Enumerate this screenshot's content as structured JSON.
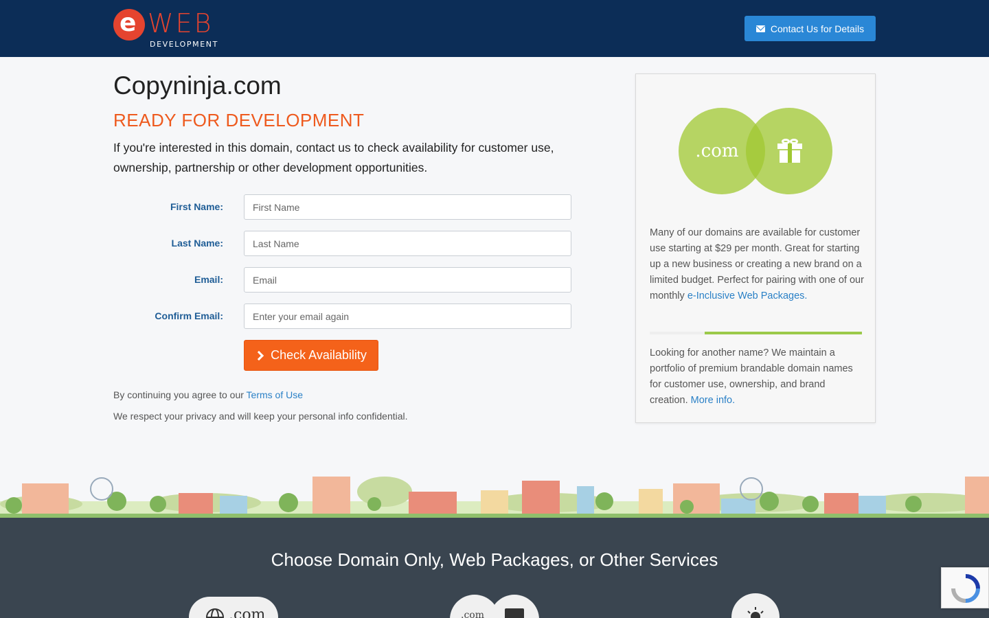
{
  "header": {
    "logo_letter": "e",
    "logo_word": "WEB",
    "logo_sub": "DEVELOPMENT",
    "contact_button": "Contact Us for Details"
  },
  "main": {
    "domain": "Copyninja.com",
    "status": "READY FOR DEVELOPMENT",
    "intro": "If you're interested in this domain, contact us to check availability for customer use, ownership, partnership or other development opportunities."
  },
  "form": {
    "first_name": {
      "label": "First Name:",
      "placeholder": "First Name"
    },
    "last_name": {
      "label": "Last Name:",
      "placeholder": "Last Name"
    },
    "email": {
      "label": "Email:",
      "placeholder": "Email"
    },
    "confirm_email": {
      "label": "Confirm Email:",
      "placeholder": "Enter your email again"
    },
    "submit": "Check Availability",
    "terms_prefix": "By continuing you agree to our ",
    "terms_link": "Terms of Use",
    "privacy": "We respect your privacy and will keep your personal info confidential."
  },
  "sidebar": {
    "dotcom": ".com",
    "para1_text": "Many of our domains are available for customer use starting at $29 per month. Great for starting up a new business or creating a new brand on a limited budget. Perfect for pairing with one of our monthly ",
    "para1_link": "e-Inclusive Web Packages.",
    "para2_text": "Looking for another name? We maintain a portfolio of premium brandable domain names for customer use, ownership, and brand creation. ",
    "para2_link": "More info."
  },
  "footer": {
    "heading": "Choose Domain Only, Web Packages, or Other Services",
    "pill1_text": ".com",
    "pill2_text": ".com"
  },
  "colors": {
    "header_bg": "#0c2d57",
    "accent_orange": "#f4621a",
    "link_blue": "#2a80c6",
    "green_circle": "#a0c832",
    "footer_bg": "#3a4550"
  }
}
